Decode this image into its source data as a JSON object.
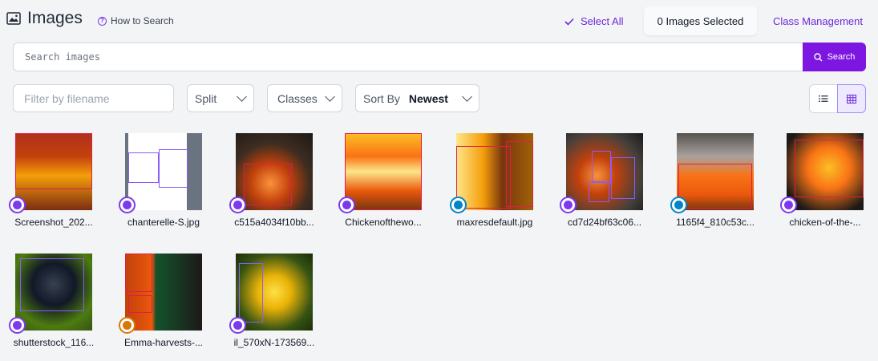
{
  "header": {
    "title": "Images",
    "how_to_search": "How to Search",
    "select_all": "Select All",
    "selected_count": "0 Images Selected",
    "class_management": "Class Management"
  },
  "search": {
    "placeholder": "Search images",
    "button": "Search"
  },
  "filters": {
    "filename_placeholder": "Filter by filename",
    "split": "Split",
    "classes": "Classes",
    "sort_label": "Sort By",
    "sort_value": "Newest"
  },
  "colors": {
    "accent": "#7c16e0",
    "annotation_purple": "#7c3aed",
    "approved_blue": "#0284c7",
    "edit_orange": "#d97706"
  },
  "images": [
    {
      "name": "Screenshot_202...",
      "status": "annotate-icon"
    },
    {
      "name": "chanterelle-S.jpg",
      "status": "annotate-icon"
    },
    {
      "name": "c515a4034f10bb...",
      "status": "annotate-icon"
    },
    {
      "name": "Chickenofthewo...",
      "status": "annotate-icon"
    },
    {
      "name": "maxresdefault.jpg",
      "status": "approved-shield-icon"
    },
    {
      "name": "cd7d24bf63c06...",
      "status": "annotate-icon"
    },
    {
      "name": "1165f4_810c53c...",
      "status": "approved-shield-icon"
    },
    {
      "name": "chicken-of-the-...",
      "status": "annotate-icon"
    },
    {
      "name": "shutterstock_116...",
      "status": "annotate-icon"
    },
    {
      "name": "Emma-harvests-...",
      "status": "edit-pencil-icon"
    },
    {
      "name": "il_570xN-173569...",
      "status": "annotate-icon"
    }
  ]
}
